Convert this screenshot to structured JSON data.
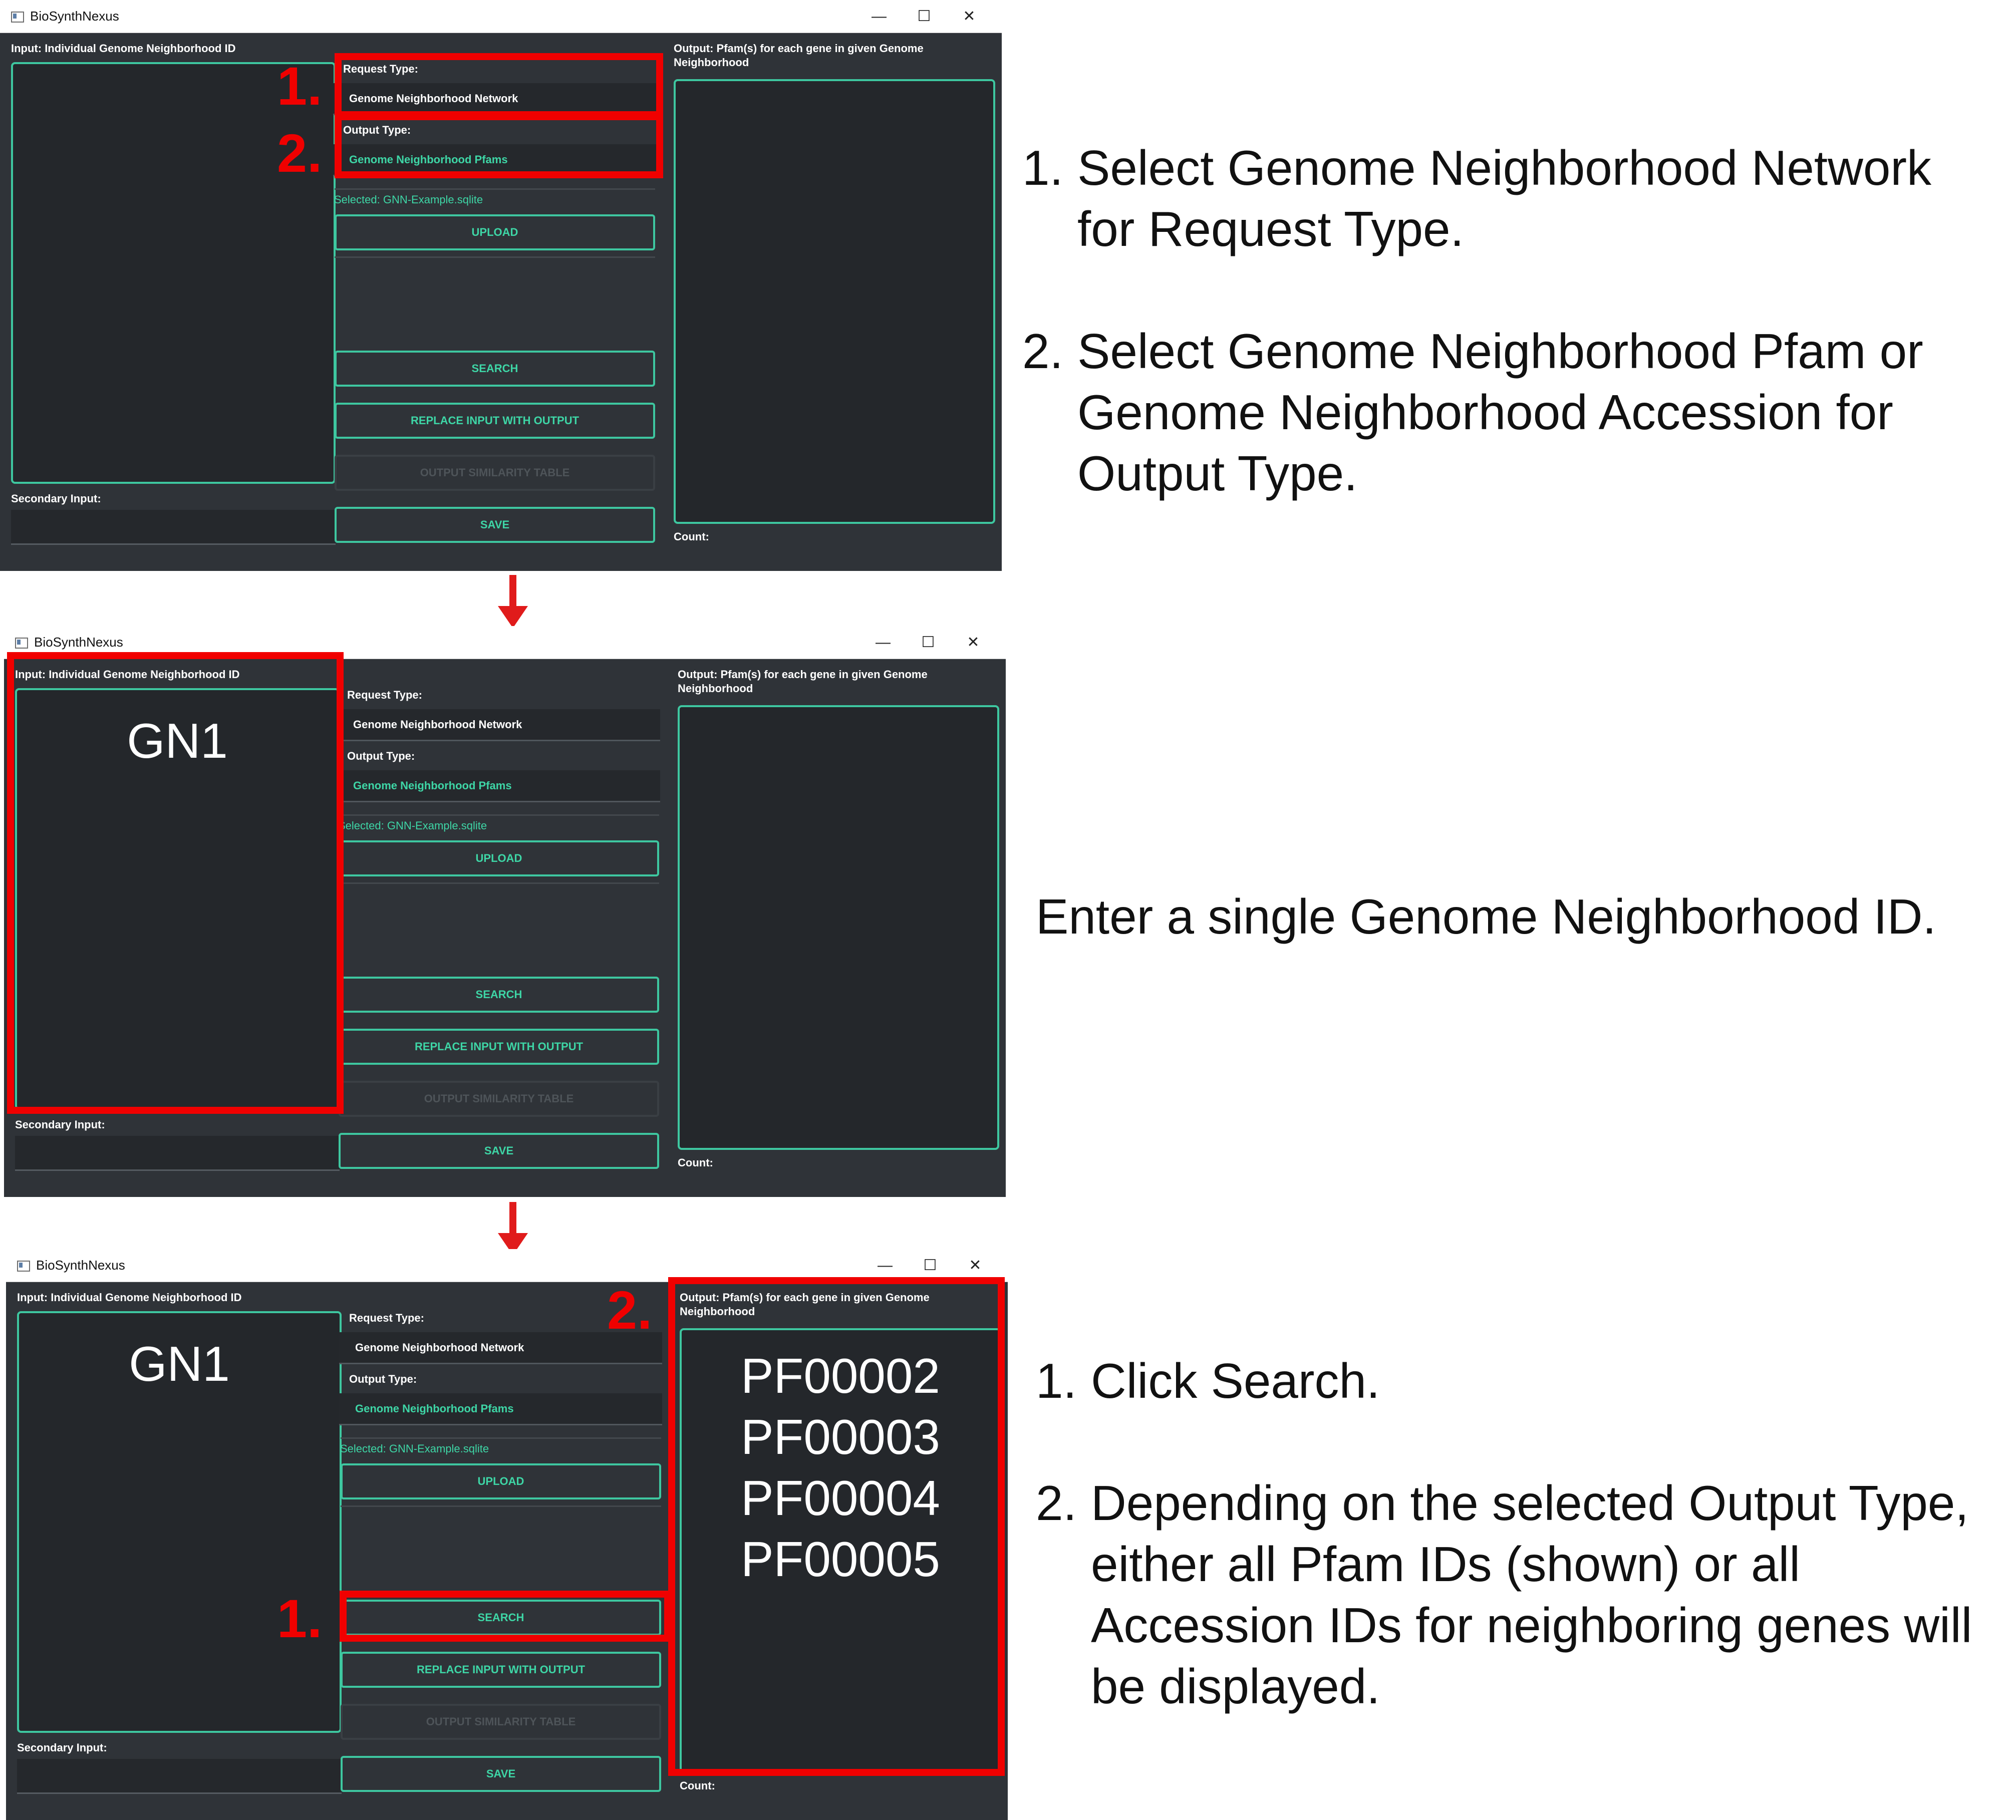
{
  "app": {
    "title": "BioSynthNexus",
    "controls": {
      "minimize": "—",
      "maximize": "☐",
      "close": "✕"
    }
  },
  "form": {
    "input_label": "Input: Individual Genome Neighborhood ID",
    "secondary_label": "Secondary Input:",
    "request_type_label": "Request Type:",
    "request_type_value": "Genome Neighborhood Network",
    "output_type_label": "Output Type:",
    "output_type_value": "Genome Neighborhood Pfams",
    "selected_file": "Selected: GNN-Example.sqlite",
    "upload_label": "UPLOAD",
    "search_label": "SEARCH",
    "replace_label": "REPLACE INPUT WITH OUTPUT",
    "similarity_label": "OUTPUT SIMILARITY TABLE",
    "save_label": "SAVE",
    "output_label_line1": "Output: Pfam(s) for each gene in given Genome",
    "output_label_line2": "Neighborhood",
    "count_label": "Count:"
  },
  "step2": {
    "input_value": "GN1"
  },
  "step3": {
    "input_value": "GN1",
    "output_values": [
      "PF00002",
      "PF00003",
      "PF00004",
      "PF00005"
    ]
  },
  "callouts": {
    "one": "1.",
    "two": "2."
  },
  "instructions": {
    "panel1": [
      {
        "num": "1.",
        "text": "Select Genome Neighborhood Network for Request Type."
      },
      {
        "num": "2.",
        "text": "Select Genome Neighborhood Pfam or Genome Neighborhood Accession for Output Type."
      }
    ],
    "panel2": "Enter a single Genome Neighborhood ID.",
    "panel3": [
      {
        "num": "1.",
        "text": "Click Search."
      },
      {
        "num": "2.",
        "text": "Depending on the selected Output Type, either all Pfam IDs (shown) or all Accession IDs for neighboring genes will be displayed."
      }
    ]
  },
  "colors": {
    "window_bg": "#2f3338",
    "field_bg": "#24272b",
    "accent": "#3ec7a0",
    "accent_text": "#3ed6a6",
    "highlight": "#f00000"
  }
}
